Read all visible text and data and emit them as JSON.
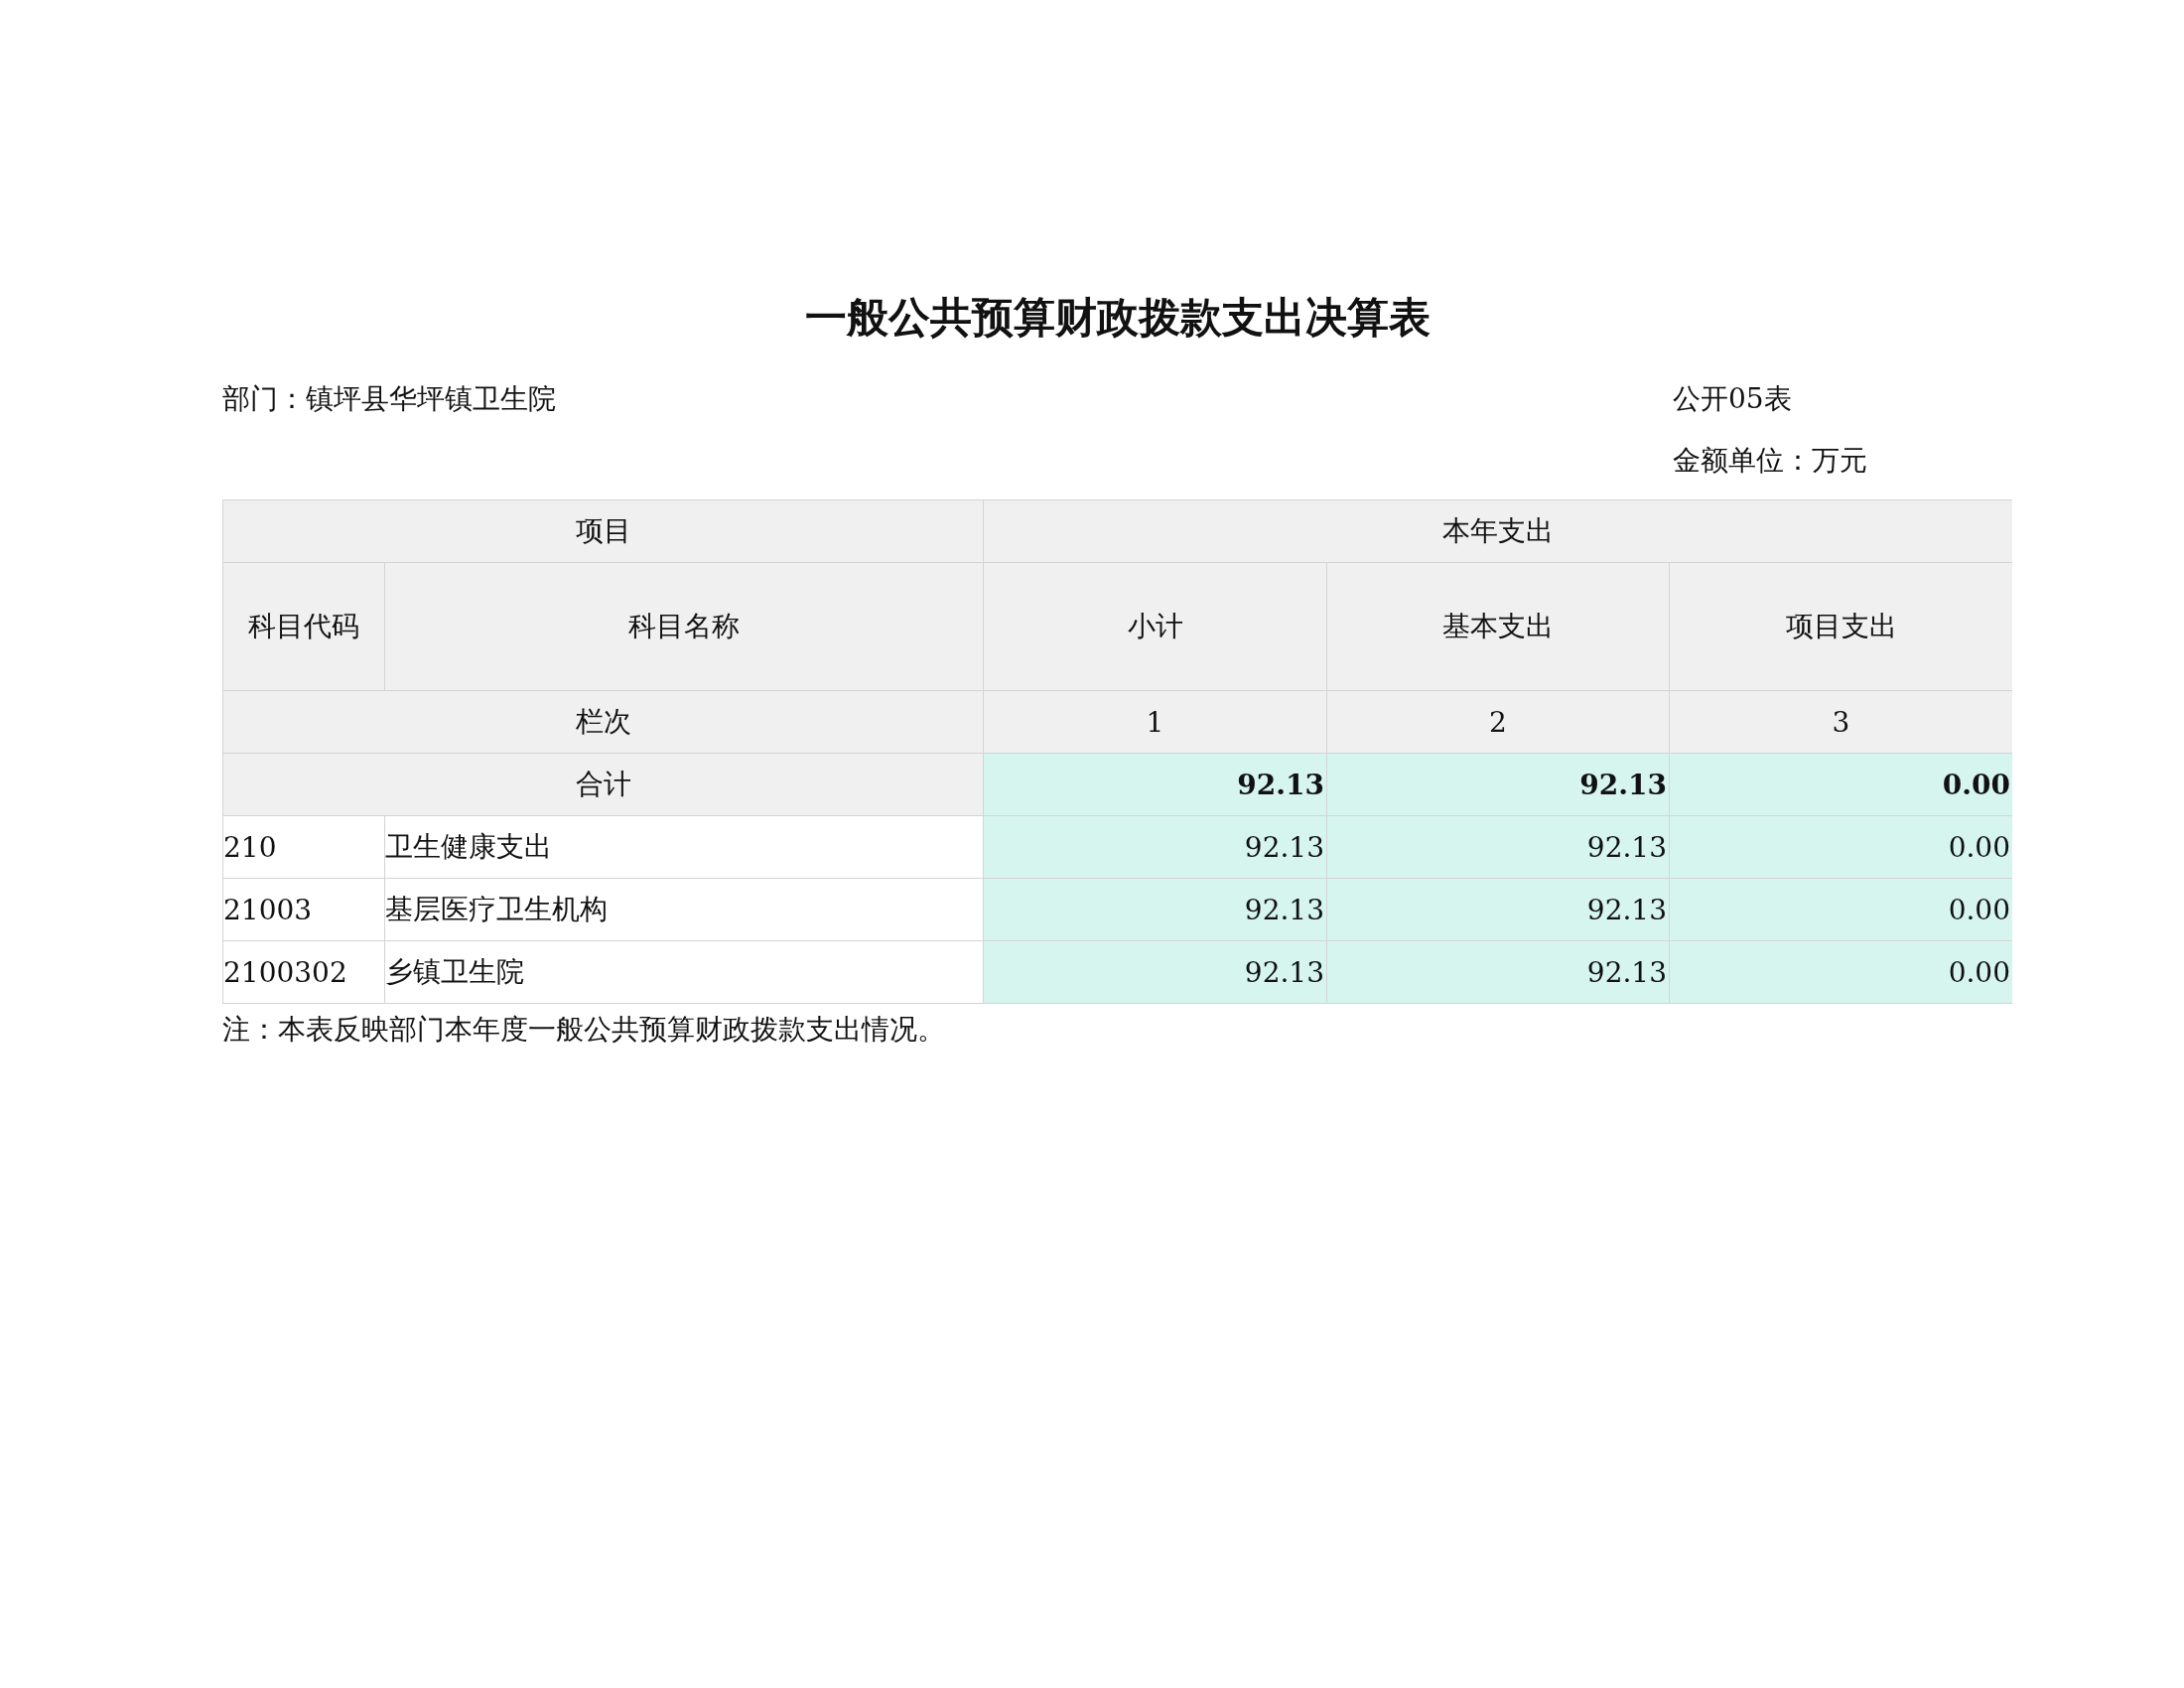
{
  "title": "一般公共预算财政拨款支出决算表",
  "department": "部门：镇坪县华坪镇卫生院",
  "table_no": "公开05表",
  "unit": "金额单位：万元",
  "table": {
    "header_groups": [
      {
        "label": "项目"
      },
      {
        "label": "本年支出"
      }
    ],
    "columns": [
      "科目代码",
      "科目名称",
      "小计",
      "基本支出",
      "项目支出"
    ],
    "column_numbers_label": "栏次",
    "column_numbers": [
      "1",
      "2",
      "3"
    ],
    "total": {
      "label": "合计",
      "values": [
        "92.13",
        "92.13",
        "0.00"
      ]
    },
    "rows": [
      {
        "code": "210",
        "name": "卫生健康支出",
        "values": [
          "92.13",
          "92.13",
          "0.00"
        ]
      },
      {
        "code": "21003",
        "name": "基层医疗卫生机构",
        "values": [
          "92.13",
          "92.13",
          "0.00"
        ]
      },
      {
        "code": "2100302",
        "name": "乡镇卫生院",
        "values": [
          "92.13",
          "92.13",
          "0.00"
        ]
      }
    ]
  },
  "note": "注：本表反映部门本年度一般公共预算财政拨款支出情况。"
}
